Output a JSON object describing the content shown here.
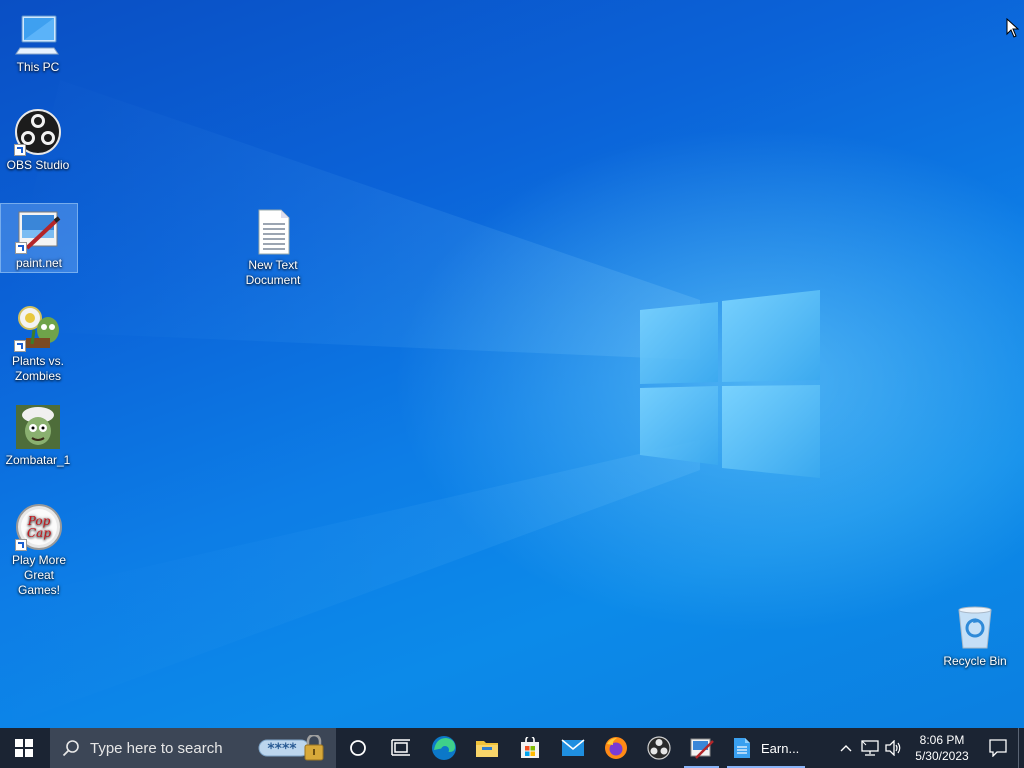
{
  "desktop": {
    "icons": [
      {
        "label": "This PC"
      },
      {
        "label": "OBS Studio"
      },
      {
        "label": "paint.net"
      },
      {
        "label": "New Text Document"
      },
      {
        "label": "Plants vs. Zombies"
      },
      {
        "label": "Zombatar_1"
      },
      {
        "label": "Play More Great Games!"
      },
      {
        "label": "Recycle Bin"
      }
    ]
  },
  "taskbar": {
    "search_placeholder": "Type here to search",
    "search_badge": "****",
    "pinned": [
      "Cortana",
      "Task View",
      "Microsoft Edge",
      "File Explorer",
      "Microsoft Store",
      "Mail",
      "Firefox",
      "OBS Studio",
      "paint.net"
    ],
    "running_app_label": "Earn...",
    "clock": {
      "time": "8:06 PM",
      "date": "5/30/2023"
    }
  },
  "colors": {
    "taskbar_bg": "#1b2433",
    "search_bg": "#3c4656",
    "accent": "#0b63d8"
  }
}
